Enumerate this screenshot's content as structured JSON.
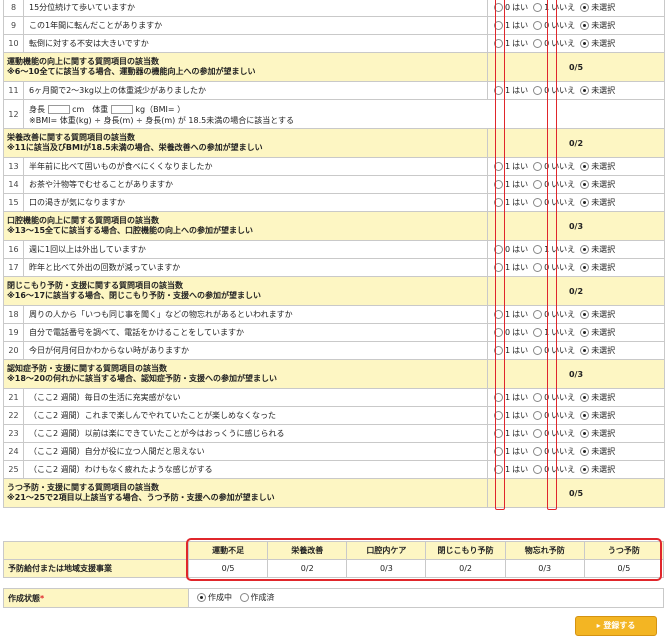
{
  "options": {
    "yes_value": "はい",
    "no_value": "いいえ",
    "unselected": "未選択",
    "score1": "1",
    "score0": "0"
  },
  "questions": [
    {
      "no": "8",
      "text": "15分位続けて歩いていますか",
      "a": "0",
      "b": "1"
    },
    {
      "no": "9",
      "text": "この1年間に転んだことがありますか",
      "a": "1",
      "b": "0"
    },
    {
      "no": "10",
      "text": "転倒に対する不安は大きいですか",
      "a": "1",
      "b": "0"
    },
    {
      "no": "11",
      "text": "6ヶ月間で2〜3kg以上の体重減少がありましたか",
      "a": "1",
      "b": "0"
    },
    {
      "no": "12",
      "text1": "身長",
      "unit_cm": "cm",
      "weight": "体重",
      "unit_kg": "kg（BMI= ）",
      "text2": "※BMI= 体重(kg) ÷ 身長(m) ÷ 身長(m) が 18.5未満の場合に該当とする"
    },
    {
      "no": "13",
      "text": "半年前に比べて固いものが食べにくくなりましたか",
      "a": "1",
      "b": "0"
    },
    {
      "no": "14",
      "text": "お茶や汁物等でむせることがありますか",
      "a": "1",
      "b": "0"
    },
    {
      "no": "15",
      "text": "口の渇きが気になりますか",
      "a": "1",
      "b": "0"
    },
    {
      "no": "16",
      "text": "週に1回以上は外出していますか",
      "a": "0",
      "b": "1"
    },
    {
      "no": "17",
      "text": "昨年と比べて外出の回数が減っていますか",
      "a": "1",
      "b": "0"
    },
    {
      "no": "18",
      "text": "周りの人から「いつも同じ事を聞く」などの物忘れがあるといわれますか",
      "a": "1",
      "b": "0"
    },
    {
      "no": "19",
      "text": "自分で電話番号を調べて、電話をかけることをしていますか",
      "a": "0",
      "b": "1"
    },
    {
      "no": "20",
      "text": "今日が何月何日かわからない時がありますか",
      "a": "1",
      "b": "0"
    },
    {
      "no": "21",
      "text": "（ここ2 週間）毎日の生活に充実感がない",
      "a": "1",
      "b": "0"
    },
    {
      "no": "22",
      "text": "（ここ2 週間）これまで楽しんでやれていたことが楽しめなくなった",
      "a": "1",
      "b": "0"
    },
    {
      "no": "23",
      "text": "（ここ2 週間）以前は楽にできていたことが今はおっくうに感じられる",
      "a": "1",
      "b": "0"
    },
    {
      "no": "24",
      "text": "（ここ2 週間）自分が役に立つ人間だと思えない",
      "a": "1",
      "b": "0"
    },
    {
      "no": "25",
      "text": "（ここ2 週間）わけもなく疲れたような感じがする",
      "a": "1",
      "b": "0"
    }
  ],
  "sections": [
    {
      "l1": "運動機能の向上に関する質問項目の該当数",
      "l2": "※6〜10全てに該当する場合、運動器の機能向上への参加が望ましい",
      "score": "0/5"
    },
    {
      "l1": "栄養改善に関する質問項目の該当数",
      "l2": "※11に該当及びBMIが18.5未満の場合、栄養改善への参加が望ましい",
      "score": "0/2"
    },
    {
      "l1": "口腔機能の向上に関する質問項目の該当数",
      "l2": "※13〜15全てに該当する場合、口腔機能の向上への参加が望ましい",
      "score": "0/3"
    },
    {
      "l1": "閉じこもり予防・支援に関する質問項目の該当数",
      "l2": "※16〜17に該当する場合、閉じこもり予防・支援への参加が望ましい",
      "score": "0/2"
    },
    {
      "l1": "認知症予防・支援に関する質問項目の該当数",
      "l2": "※18〜20の何れかに該当する場合、認知症予防・支援への参加が望ましい",
      "score": "0/3"
    },
    {
      "l1": "うつ予防・支援に関する質問項目の該当数",
      "l2": "※21〜25で2項目以上該当する場合、うつ予防・支援への参加が望ましい",
      "score": "0/5"
    }
  ],
  "summary": {
    "label": "予防給付または地域支援事業",
    "headers": [
      "運動不足",
      "栄養改善",
      "口腔内ケア",
      "閉じこもり予防",
      "物忘れ予防",
      "うつ予防"
    ],
    "values": [
      "0/5",
      "0/2",
      "0/3",
      "0/2",
      "0/3",
      "0/5"
    ]
  },
  "status": {
    "label": "作成状態",
    "required": "*",
    "opt1": "作成中",
    "opt2": "作成済"
  },
  "register_button": "▸ 登録する",
  "colors": {
    "highlight": "#e0262b",
    "section_bg": "#fdf6c3",
    "button": "#f3b523"
  }
}
